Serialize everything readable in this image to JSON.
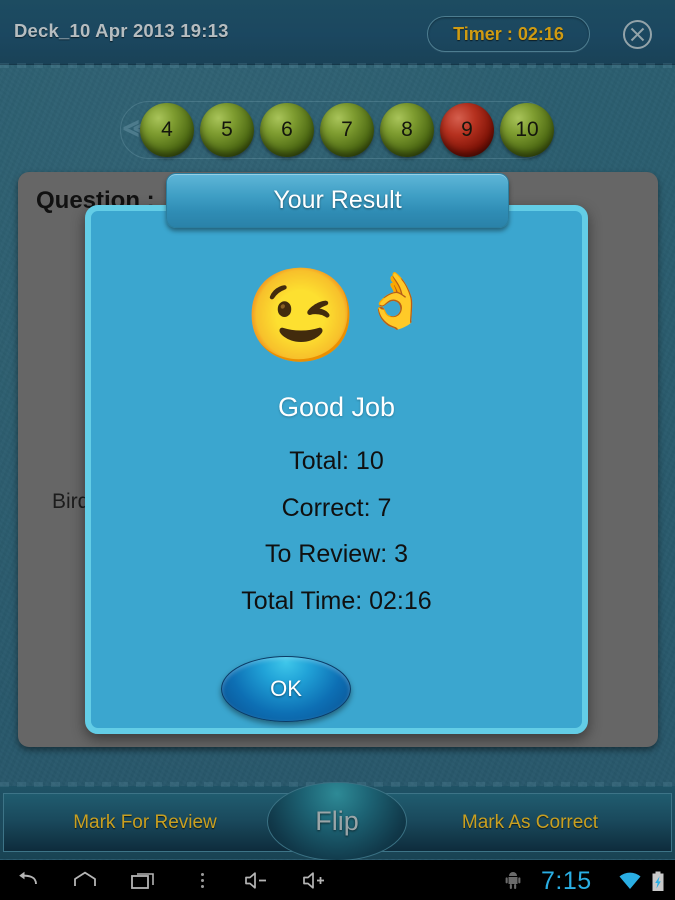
{
  "header": {
    "deck_title": "Deck_10 Apr 2013 19:13",
    "timer_label": "Timer : 02:16",
    "close_icon": "close-circle-icon",
    "title_color": "#b6bdc0",
    "timer_color": "#cf9b12"
  },
  "pill_nav": {
    "prev_icon": "double-chevron-left-icon",
    "items": [
      {
        "label": "4",
        "state": "normal"
      },
      {
        "label": "5",
        "state": "normal"
      },
      {
        "label": "6",
        "state": "normal"
      },
      {
        "label": "7",
        "state": "normal"
      },
      {
        "label": "8",
        "state": "normal"
      },
      {
        "label": "9",
        "state": "marked"
      },
      {
        "label": "10",
        "state": "normal"
      }
    ],
    "normal_color": "#7e9c30",
    "marked_color": "#b5311f"
  },
  "question_card": {
    "title": "Question :",
    "body_text": "Bird"
  },
  "dialog": {
    "title": "Your Result",
    "emoji_face": "😉",
    "emoji_hand": "👌",
    "face_icon_name": "winking-smiley-icon",
    "hand_icon_name": "ok-hand-icon",
    "headline": "Good Job",
    "stats": [
      "Total: 10",
      "Correct: 7",
      "To Review: 3",
      "Total Time: 02:16"
    ],
    "stat_values": {
      "total": 10,
      "correct": 7,
      "to_review": 3,
      "total_time": "02:16"
    },
    "ok_label": "OK",
    "body_color": "#3ba6cf",
    "border_color": "#63cde6"
  },
  "bottom_bar": {
    "mark_for_review": "Mark For Review",
    "flip": "Flip",
    "mark_as_correct": "Mark As Correct",
    "label_color": "#c9a021"
  },
  "navbar": {
    "back_icon": "back-arrow-icon",
    "home_icon": "home-icon",
    "recents_icon": "recent-apps-icon",
    "menu_icon": "overflow-menu-icon",
    "volume_down_icon": "volume-down-icon",
    "volume_up_icon": "volume-up-icon",
    "android_icon": "android-robot-icon",
    "time": "7:15",
    "wifi_icon": "wifi-icon",
    "battery_icon": "battery-charging-icon",
    "time_color": "#2aaee3"
  }
}
